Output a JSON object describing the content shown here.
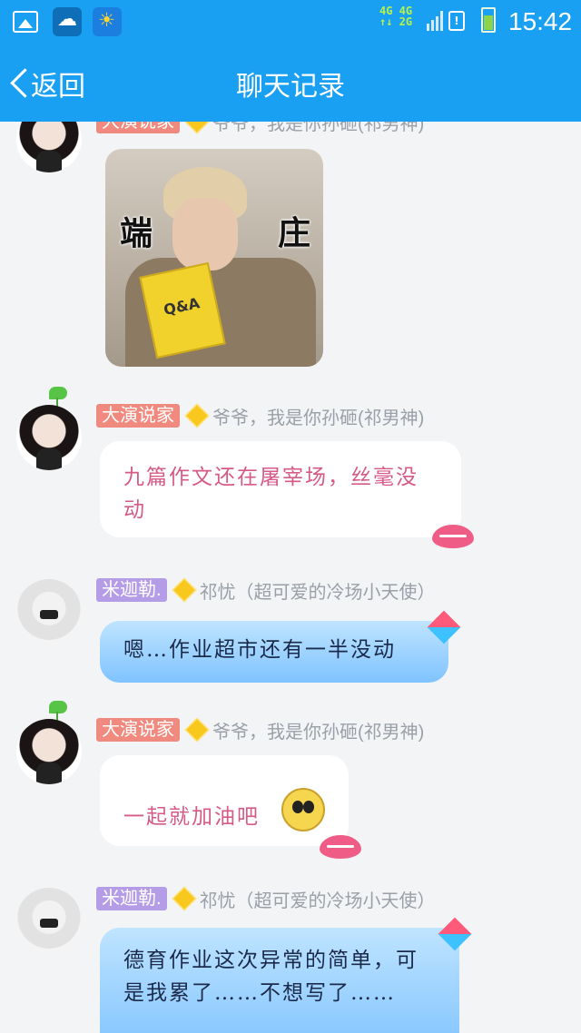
{
  "status_bar": {
    "network": "4G 4G\n↑↓ 2G",
    "time": "15:42",
    "alert": "!"
  },
  "title_bar": {
    "back_label": "返回",
    "title": "聊天记录"
  },
  "messages": [
    {
      "badge": "大演说家",
      "name": "爷爷，我是你孙砸(祁男神)",
      "sticker_words": [
        "端",
        "庄"
      ],
      "sticker_book": "Q&A"
    },
    {
      "badge": "大演说家",
      "name": "爷爷，我是你孙砸(祁男神)",
      "text": "九篇作文还在屠宰场，丝毫没动"
    },
    {
      "badge": "米迦勒.",
      "name": "祁忧（超可爱的冷场小天使）",
      "text": "嗯…作业超市还有一半没动"
    },
    {
      "badge": "大演说家",
      "name": "爷爷，我是你孙砸(祁男神)",
      "text": "一起就加油吧"
    },
    {
      "badge": "米迦勒.",
      "name": "祁忧（超可爱的冷场小天使）",
      "text": "德育作业这次异常的简单，可是我累了……不想写了……"
    }
  ]
}
